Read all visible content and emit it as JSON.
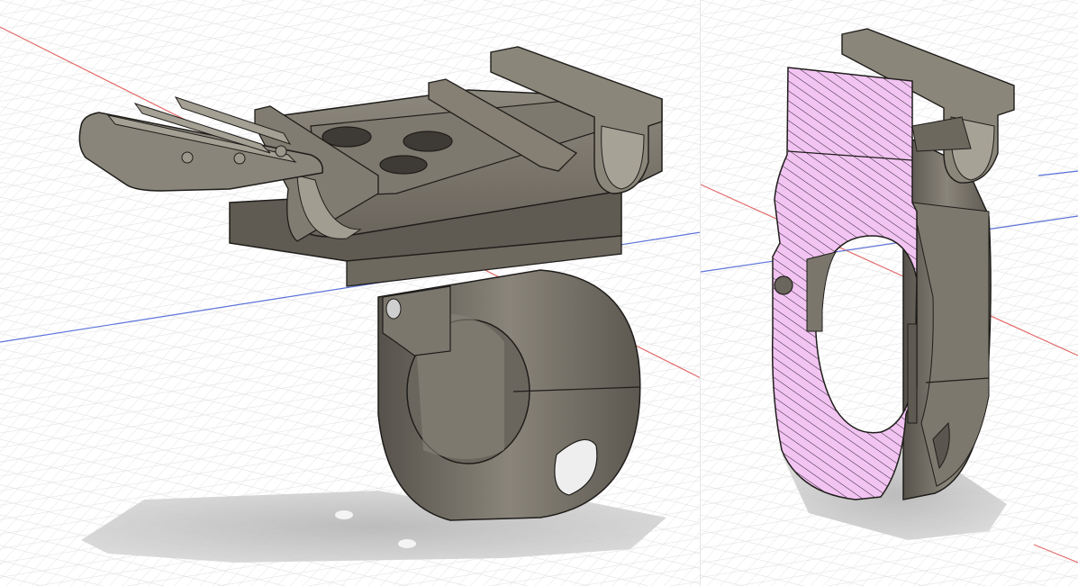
{
  "viewport": {
    "background_color": "#ffffff",
    "grid_color": "#d9d9d9",
    "grid_major_color": "#c6c6c6",
    "x_axis_color": "#e36a6a",
    "y_axis_color": "#5b73d9"
  },
  "model": {
    "body_color": "#6f6a60",
    "body_light_color": "#8e897e",
    "body_dark_color": "#4e4a43",
    "edge_color": "#1f1d1a",
    "shadow_color": "#bdbdbd",
    "section_fill_color": "#f2c4f2",
    "section_hatch_color": "#2a1f2a"
  },
  "panes": {
    "left": {
      "content": "full-model-view"
    },
    "right": {
      "content": "section-analysis-view"
    }
  }
}
